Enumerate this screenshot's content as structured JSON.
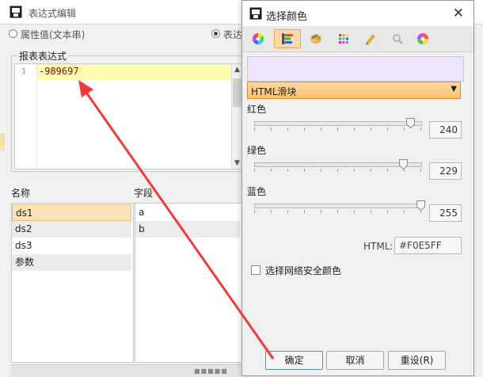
{
  "editor_window": {
    "title": "表达式编辑",
    "radio_text": "属性值(文本串)",
    "radio_expr": "表达",
    "group_label": "报表表达式",
    "line_number": "1",
    "expression": "-989697",
    "names_header": "名称",
    "fields_header": "字段",
    "names": [
      "ds1",
      "ds2",
      "ds3",
      "参数"
    ],
    "fields": [
      "a",
      "b"
    ]
  },
  "color_dialog": {
    "title": "选择颜色",
    "close_glyph": "✕",
    "tabs": [
      "color-wheel-icon",
      "sliders-icon",
      "palette-icon",
      "swatches-icon",
      "crayon-icon",
      "eyedropper-icon",
      "rgb-wheel-icon"
    ],
    "mode_select": "HTML滑块",
    "sliders": [
      {
        "label": "红色",
        "value": "240",
        "fraction": 0.941
      },
      {
        "label": "绿色",
        "value": "229",
        "fraction": 0.898
      },
      {
        "label": "蓝色",
        "value": "255",
        "fraction": 1.0
      }
    ],
    "html_label": "HTML:",
    "html_value": "#F0E5FF",
    "websafe_label": "选择网络安全颜色",
    "ok": "确定",
    "cancel": "取消",
    "reset": "重设(R)",
    "preview_color": "#F0E5FF"
  }
}
